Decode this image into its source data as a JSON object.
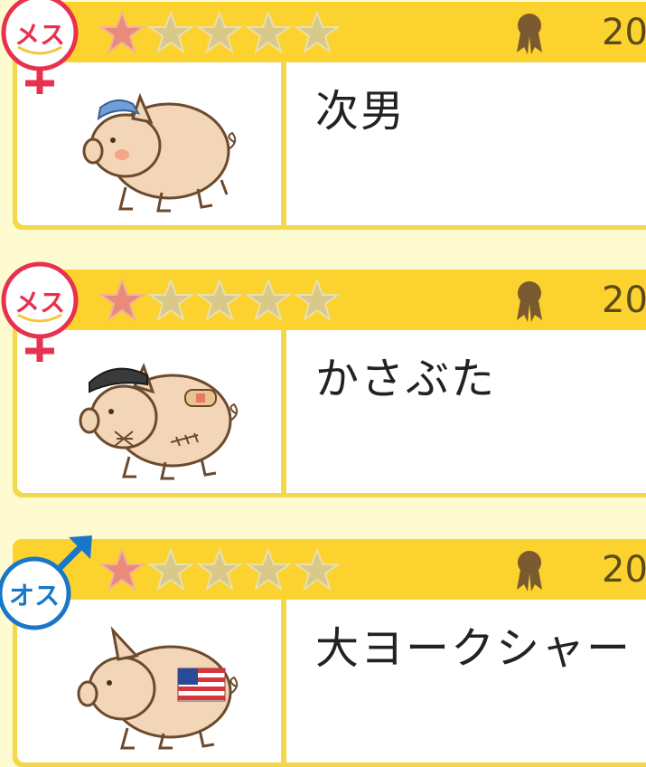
{
  "cards": [
    {
      "gender": "female",
      "gender_label": "メス",
      "rating": 1,
      "max_rating": 5,
      "year": "20",
      "name": "次男",
      "pig_accessory": "blue-cap"
    },
    {
      "gender": "female",
      "gender_label": "メス",
      "rating": 1,
      "max_rating": 5,
      "year": "20",
      "name": "かさぶた",
      "pig_accessory": "police-cap-with-bandages"
    },
    {
      "gender": "male",
      "gender_label": "オス",
      "rating": 1,
      "max_rating": 5,
      "year": "20",
      "name": "大ヨークシャー",
      "pig_accessory": "us-flag"
    }
  ],
  "colors": {
    "female": "#e8304f",
    "male": "#1877c8",
    "star_on": "#e98a7c",
    "star_off": "#d8c98a",
    "header": "#fcd22e",
    "medal": "#7a5a2e"
  }
}
